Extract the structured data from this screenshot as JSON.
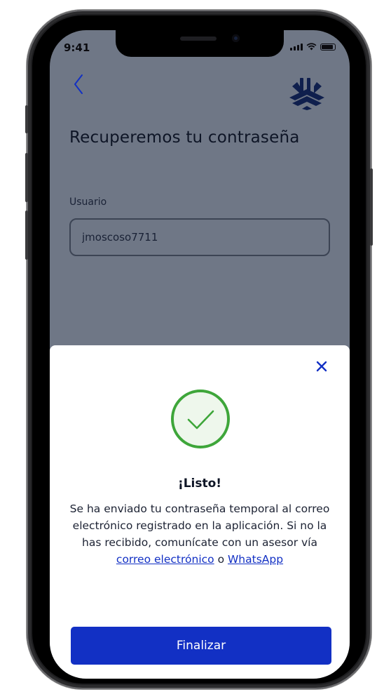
{
  "status_bar": {
    "time": "9:41"
  },
  "header": {
    "back_icon": "chevron-left-icon",
    "logo_icon": "brand-logo-icon"
  },
  "form": {
    "title": "Recuperemos tu contraseña",
    "username_label": "Usuario",
    "username_value": "jmoscoso7711"
  },
  "sheet": {
    "close_icon": "close-icon",
    "success_icon": "check-circle-icon",
    "title": "¡Listo!",
    "message_prefix": "Se ha enviado tu contraseña temporal al correo electrónico registrado en la aplicación. Si no la has recibido, comunícate con un asesor vía ",
    "email_link": "correo electrónico",
    "connector": " o ",
    "whatsapp_link": "WhatsApp",
    "finish_button": "Finalizar"
  },
  "colors": {
    "overlay": "#6f7786",
    "primary": "#1230c4",
    "success": "#3ea63a",
    "success_bg": "#eef7ec"
  }
}
